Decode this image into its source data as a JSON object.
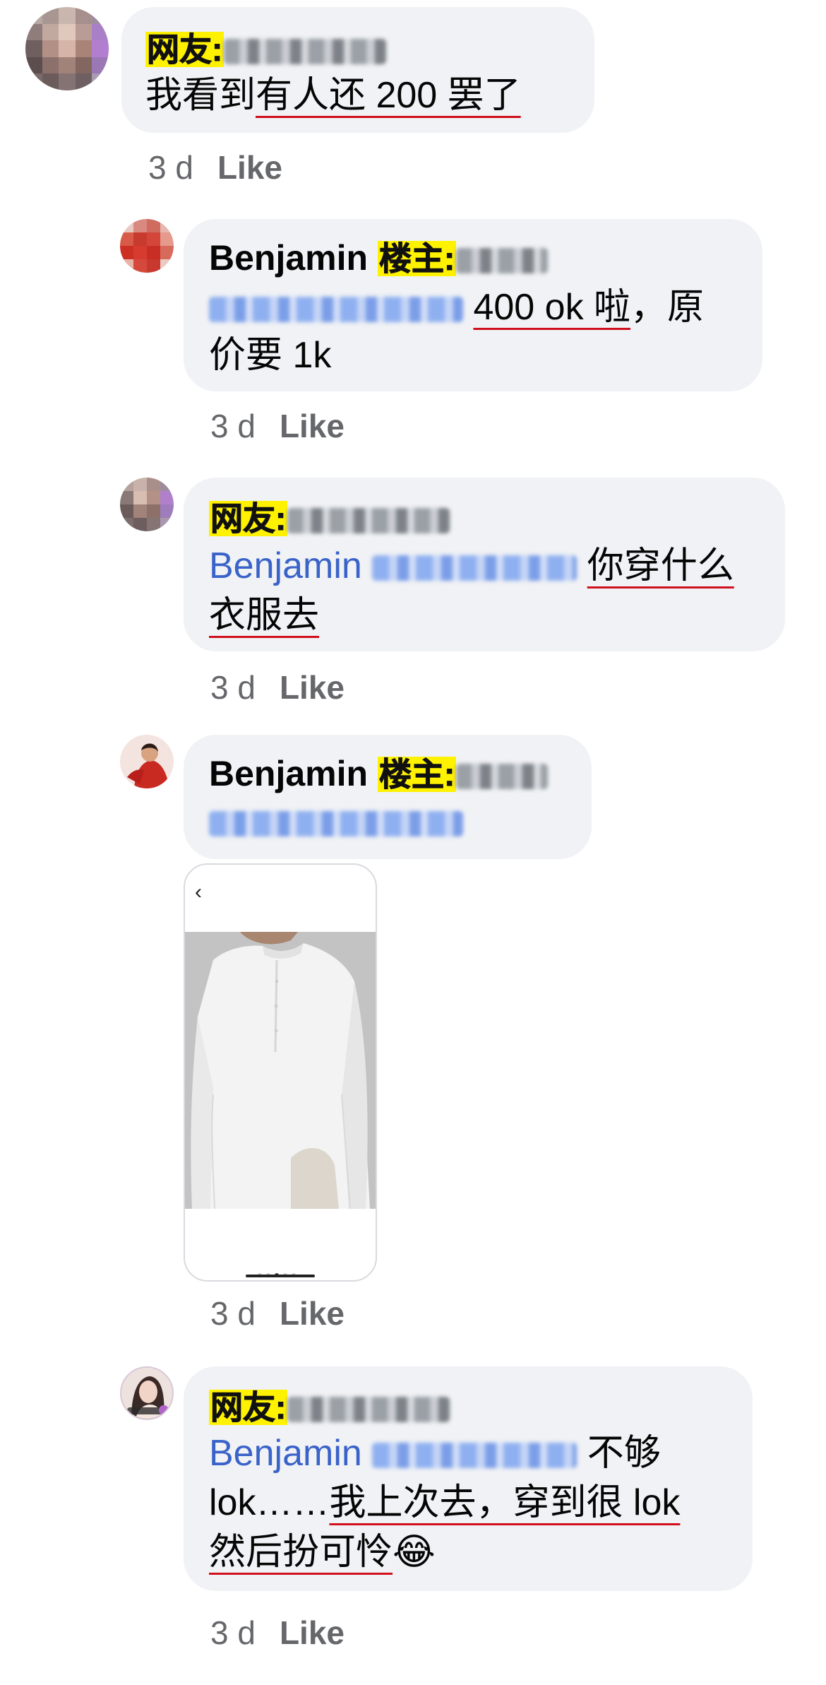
{
  "labels": {
    "netizen": "网友:",
    "op": "楼主:",
    "op_name": "Benjamin",
    "mention_name": "Benjamin"
  },
  "comments": [
    {
      "line1": "我看到",
      "line1_ul": "有人还 200 罢了",
      "time": "3 d",
      "like": "Like"
    },
    {
      "mention_tail": "400 ok 啦",
      "line1_after": "，原",
      "line2": "价要 1k",
      "time": "3 d",
      "like": "Like"
    },
    {
      "line1_ul": "你穿什么",
      "line2_ul": "衣服去",
      "time": "3 d",
      "like": "Like"
    },
    {
      "photo_back": "‹",
      "time": "3 d",
      "like": "Like"
    },
    {
      "line1_tail": "不够",
      "line2_a": "lok……",
      "line2_ul": "我上次去，穿到很 lok",
      "line3_ul": "然后扮可怜",
      "emoji": "😂",
      "time": "3 d",
      "like": "Like"
    }
  ],
  "icons": {
    "shirt": "shirt-photo",
    "laugh": "tears-of-joy-emoji"
  },
  "colors": {
    "bubble": "#f0f2f5",
    "mention": "#3a63c9",
    "highlight": "#fff200",
    "underline": "#d0101d",
    "meta": "#65676b"
  }
}
